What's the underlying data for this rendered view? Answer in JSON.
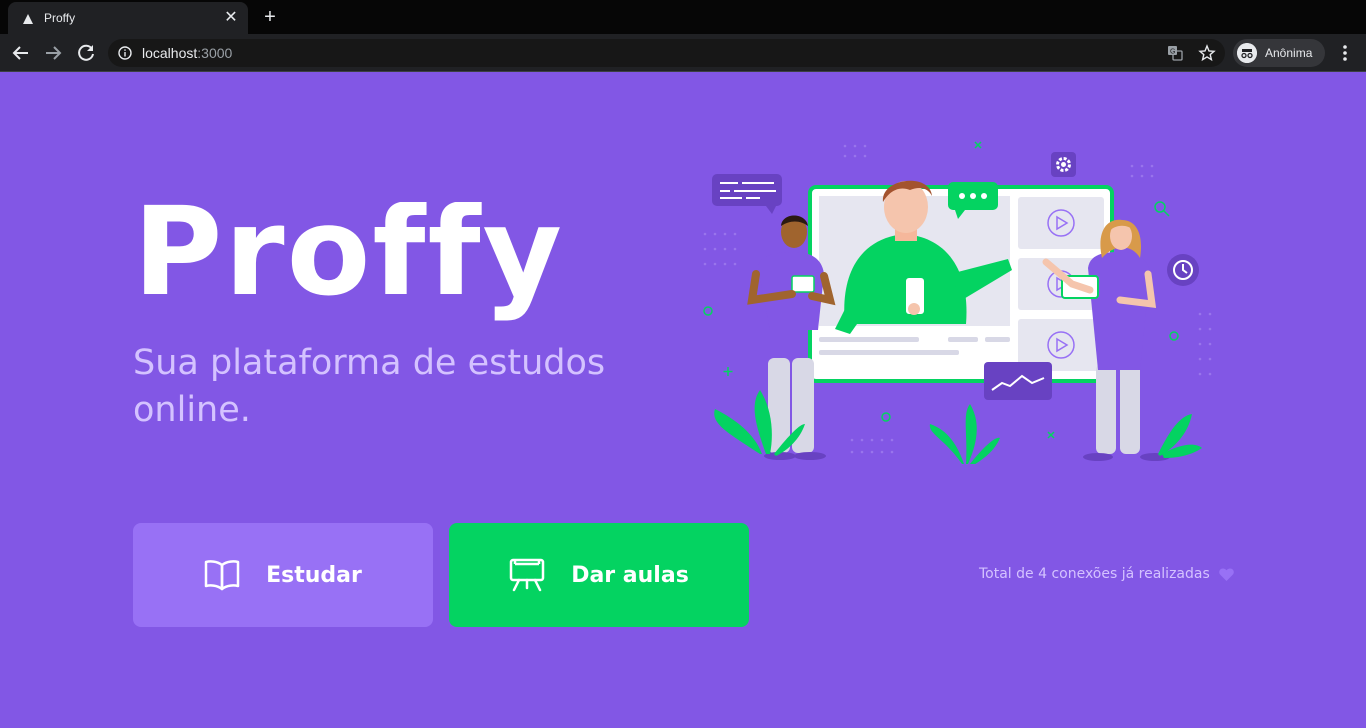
{
  "browser": {
    "tab_title": "Proffy",
    "new_tab_symbol": "+",
    "close_symbol": "✕",
    "url_host": "localhost",
    "url_port": ":3000",
    "profile_label": "Anônima",
    "icons": [
      "back-arrow-icon",
      "forward-arrow-icon",
      "reload-icon",
      "info-icon",
      "translate-icon",
      "star-icon",
      "incognito-icon",
      "menu-dots-icon"
    ]
  },
  "page": {
    "logo_text": "Proffy",
    "subtitle": "Sua plataforma de estudos online.",
    "buttons": {
      "study_label": "Estudar",
      "teach_label": "Dar aulas"
    },
    "connections_text": "Total de 4 conexões já realizadas",
    "colors": {
      "background": "#8257e5",
      "study_button": "#9871f5",
      "teach_button": "#04d361",
      "text_light": "#d4c2ff",
      "accent_green": "#04d361"
    }
  }
}
